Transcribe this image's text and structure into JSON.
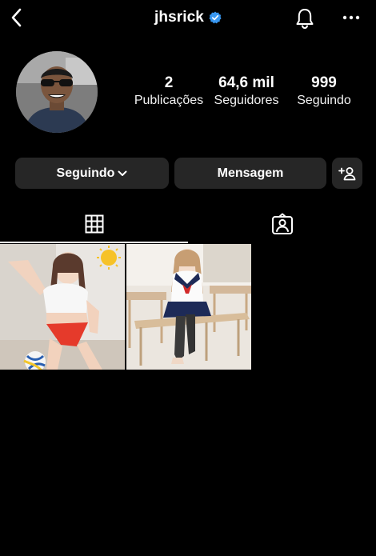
{
  "header": {
    "username": "jhsrick",
    "verified": true
  },
  "stats": [
    {
      "value": "2",
      "label": "Publicações"
    },
    {
      "value": "64,6 mil",
      "label": "Seguidores"
    },
    {
      "value": "999",
      "label": "Seguindo"
    }
  ],
  "actions": {
    "following_label": "Seguindo",
    "message_label": "Mensagem"
  },
  "tabs": [
    {
      "icon": "grid-icon",
      "active": true
    },
    {
      "icon": "tagged-icon",
      "active": false
    }
  ],
  "colors": {
    "verified": "#3897f0",
    "button_bg": "#262626",
    "background": "#000000"
  }
}
